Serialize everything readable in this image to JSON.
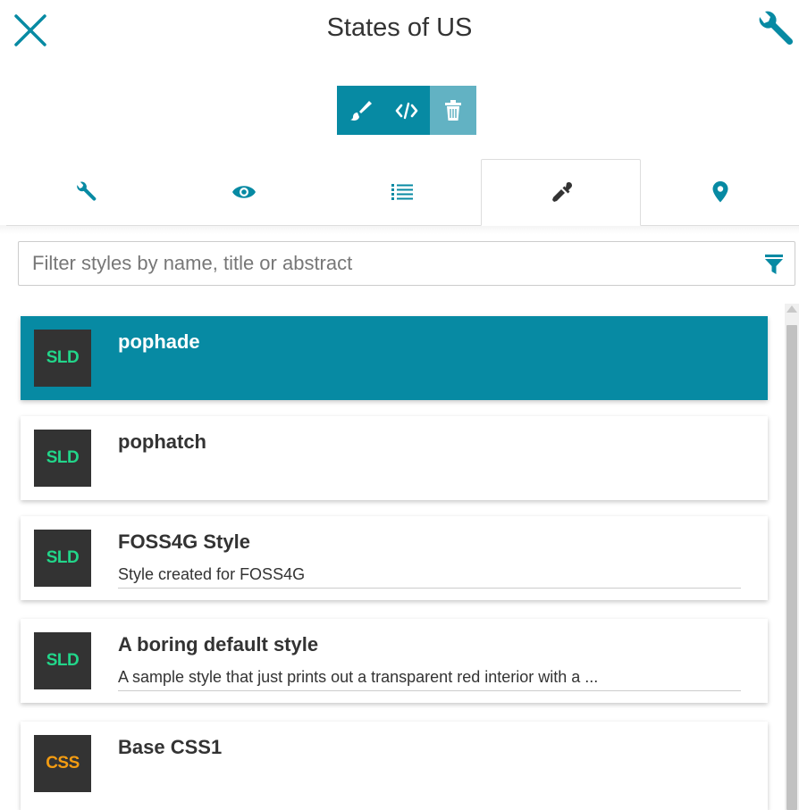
{
  "header": {
    "title": "States of US",
    "close_icon": "close-x-icon",
    "settings_icon": "wrench-icon"
  },
  "toolbar": {
    "buttons": [
      {
        "icon": "brush-icon",
        "enabled": true
      },
      {
        "icon": "code-icon",
        "enabled": true
      },
      {
        "icon": "trash-icon",
        "enabled": false
      }
    ]
  },
  "tabs": [
    {
      "icon": "wrench-icon",
      "active": false
    },
    {
      "icon": "eye-icon",
      "active": false
    },
    {
      "icon": "list-icon",
      "active": false
    },
    {
      "icon": "eyedropper-icon",
      "active": true
    },
    {
      "icon": "map-marker-icon",
      "active": false
    }
  ],
  "filter": {
    "placeholder": "Filter styles by name, title or abstract",
    "value": "",
    "icon": "filter-icon"
  },
  "styles": [
    {
      "format": "SLD",
      "title": "pophade",
      "abstract": "",
      "selected": true
    },
    {
      "format": "SLD",
      "title": "pophatch",
      "abstract": "",
      "selected": false
    },
    {
      "format": "SLD",
      "title": "FOSS4G Style",
      "abstract": "Style created for FOSS4G",
      "selected": false
    },
    {
      "format": "SLD",
      "title": "A boring default style",
      "abstract": "A sample style that just prints out a transparent red interior with a ...",
      "selected": false
    },
    {
      "format": "CSS",
      "title": "Base CSS1",
      "abstract": "",
      "selected": false
    }
  ],
  "colors": {
    "accent": "#078aa3",
    "accent_disabled": "#62b2c3",
    "sld_badge_text": "#22d68a",
    "css_badge_text": "#f39c12",
    "badge_bg": "#333333"
  }
}
